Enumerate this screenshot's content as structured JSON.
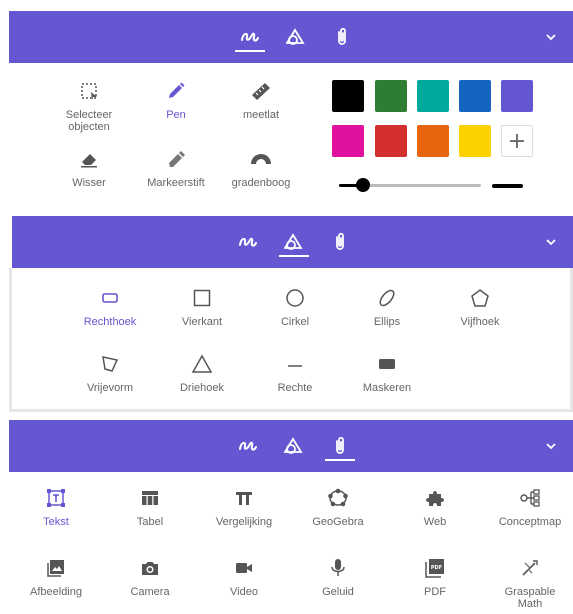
{
  "colors": {
    "accent": "#6557d2",
    "swatches": [
      "#000000",
      "#2e7d32",
      "#00a99d",
      "#1565c0",
      "#6557d2",
      "#e0119f",
      "#d32f2f",
      "#e8650f",
      "#fdd000"
    ]
  },
  "pen_panel": {
    "tools": [
      {
        "label": "Selecteer\nobjecten",
        "icon": "select-objects-icon"
      },
      {
        "label": "Pen",
        "icon": "pen-icon"
      },
      {
        "label": "meetlat",
        "icon": "ruler-icon"
      },
      {
        "label": "Wisser",
        "icon": "eraser-icon"
      },
      {
        "label": "Markeerstift",
        "icon": "highlighter-icon"
      },
      {
        "label": "gradenboog",
        "icon": "protractor-icon"
      }
    ],
    "add_color": "+"
  },
  "shapes_panel": {
    "tools": [
      {
        "label": "Rechthoek",
        "icon": "rectangle-icon"
      },
      {
        "label": "Vierkant",
        "icon": "square-icon"
      },
      {
        "label": "Cirkel",
        "icon": "circle-icon"
      },
      {
        "label": "Ellips",
        "icon": "ellipse-icon"
      },
      {
        "label": "Vijfhoek",
        "icon": "pentagon-icon"
      },
      {
        "label": "Vrijevorm",
        "icon": "freeform-icon"
      },
      {
        "label": "Driehoek",
        "icon": "triangle-icon"
      },
      {
        "label": "Rechte",
        "icon": "line-icon"
      },
      {
        "label": "Maskeren",
        "icon": "mask-icon"
      }
    ]
  },
  "media_panel": {
    "tools": [
      {
        "label": "Tekst",
        "icon": "text-icon"
      },
      {
        "label": "Tabel",
        "icon": "table-icon"
      },
      {
        "label": "Vergelijking",
        "icon": "equation-icon"
      },
      {
        "label": "GeoGebra",
        "icon": "geogebra-icon"
      },
      {
        "label": "Web",
        "icon": "web-icon"
      },
      {
        "label": "Conceptmap",
        "icon": "conceptmap-icon"
      },
      {
        "label": "Afbeelding",
        "icon": "image-icon"
      },
      {
        "label": "Camera",
        "icon": "camera-icon"
      },
      {
        "label": "Video",
        "icon": "video-icon"
      },
      {
        "label": "Geluid",
        "icon": "microphone-icon"
      },
      {
        "label": "PDF",
        "icon": "pdf-icon"
      },
      {
        "label": "Graspable\nMath",
        "icon": "graspable-math-icon"
      }
    ]
  }
}
